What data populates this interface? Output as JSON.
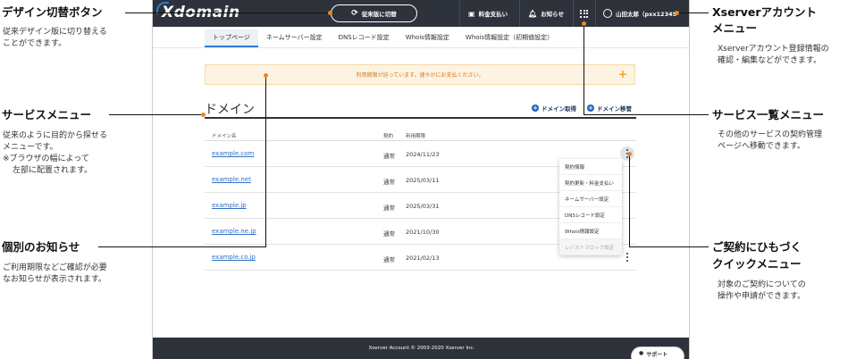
{
  "annotations": {
    "design_switch": {
      "title": "デザイン切替ボタン",
      "desc": [
        "従来デザイン版に切り替える",
        "ことができます。"
      ]
    },
    "service_menu": {
      "title": "サービスメニュー",
      "desc": [
        "従来のように目的から探せる",
        "メニューです。",
        "※ブラウザの幅によって",
        "左部に配置されます。"
      ]
    },
    "notice": {
      "title": "個別のお知らせ",
      "desc": [
        "ご利用期限などご確認が必要",
        "なお知らせが表示されます。"
      ]
    },
    "account": {
      "title": [
        "Xserverアカウント",
        "メニュー"
      ],
      "desc": [
        "Xserverアカウント登録情報の",
        "確認・編集などができます。"
      ]
    },
    "service_list": {
      "title": "サービス一覧メニュー",
      "desc": [
        "その他のサービスの契約管理",
        "ページへ移動できます。"
      ]
    },
    "quick_menu": {
      "title": [
        "ご契約にひもづく",
        "クイックメニュー"
      ],
      "desc": [
        "対象のご契約についての",
        "操作や申請ができます。"
      ]
    }
  },
  "app": {
    "logo": "Xdomain",
    "switch_button": "従来版に切替",
    "pay": "料金支払い",
    "news": "お知らせ",
    "user": "山田太郎（pxx12345"
  },
  "tabs": [
    "トップページ",
    "ネームサーバー設定",
    "DNSレコード設定",
    "Whois情報設定",
    "Whois情報設定（初期値設定）"
  ],
  "notice_text": "利用期限が迫っています。速やかにお支払ください。",
  "notice_plus": "+",
  "section": {
    "title": "ドメイン",
    "acquire": "ドメイン取得",
    "transfer": "ドメイン移管",
    "plus": "+"
  },
  "table": {
    "headers": [
      "ドメイン名",
      "契約",
      "利用期限"
    ],
    "rows": [
      {
        "domain": "example.com",
        "contract": "通常",
        "expiry": "2024/11/23"
      },
      {
        "domain": "example.net",
        "contract": "通常",
        "expiry": "2025/03/11"
      },
      {
        "domain": "example.jp",
        "contract": "通常",
        "expiry": "2025/03/31"
      },
      {
        "domain": "example.ne.jp",
        "contract": "通常",
        "expiry": "2021/10/30"
      },
      {
        "domain": "example.co.jp",
        "contract": "通常",
        "expiry": "2021/02/13"
      }
    ]
  },
  "quick_menu": [
    "契約情報",
    "契約更新・料金支払い",
    "ネームサーバー設定",
    "DNSレコード設定",
    "Whois情報設定",
    "レジストラロック設定"
  ],
  "footer": "Xserver Account © 2003-2020 Xserver Inc.",
  "support": "サポート",
  "colors": {
    "accent": "#e8891d",
    "header": "#2d323b",
    "link": "#2f6fc6",
    "notice_bg": "#fdf3e3"
  }
}
